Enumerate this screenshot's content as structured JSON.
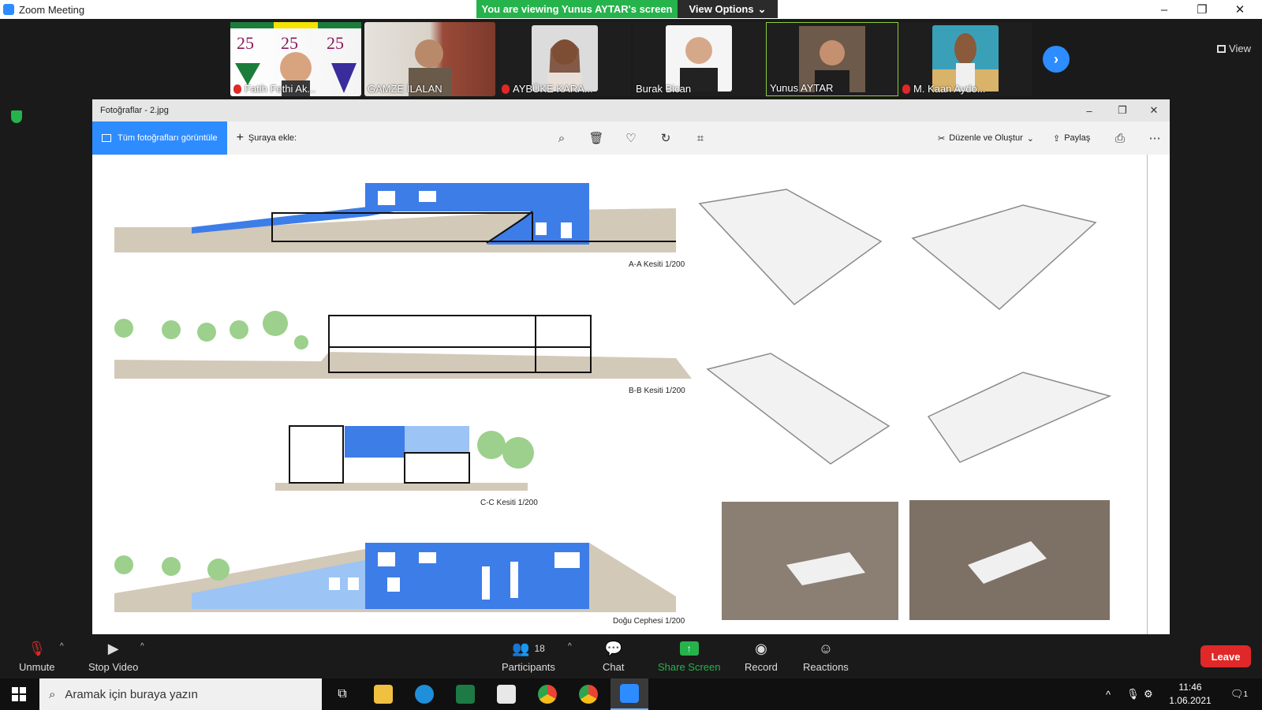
{
  "zoom": {
    "window_title": "Zoom Meeting",
    "viewing_banner": "You are viewing Yunus AYTAR's screen",
    "view_options": "View Options",
    "view_label": "View"
  },
  "participants": [
    {
      "name": "Fatih Fethi Ak...",
      "muted": true,
      "active": false
    },
    {
      "name": "GAMZE İLALAN",
      "muted": false,
      "active": false
    },
    {
      "name": "AYBÜKE KARA...",
      "muted": true,
      "active": false
    },
    {
      "name": "Burak Bican",
      "muted": false,
      "active": false
    },
    {
      "name": "Yunus AYTAR",
      "muted": false,
      "active": true
    },
    {
      "name": "M. Kaan Aydo...",
      "muted": true,
      "active": false
    }
  ],
  "photos_app": {
    "title": "Fotoğraflar - 2.jpg",
    "all_photos": "Tüm fotoğrafları görüntüle",
    "add_to": "Şuraya ekle:",
    "edit_create": "Düzenle ve Oluştur",
    "share": "Paylaş"
  },
  "drawing": {
    "labels": {
      "aa": "A-A Kesiti 1/200",
      "bb": "B-B Kesiti 1/200",
      "cc": "C-C Kesiti 1/200",
      "east": "Doğu Cephesi 1/200"
    }
  },
  "controls": {
    "unmute": "Unmute",
    "stop_video": "Stop Video",
    "participants": "Participants",
    "participants_count": "18",
    "chat": "Chat",
    "share_screen": "Share Screen",
    "record": "Record",
    "reactions": "Reactions",
    "leave": "Leave"
  },
  "taskbar": {
    "search_placeholder": "Aramak için buraya yazın",
    "time": "11:46",
    "date": "1.06.2021",
    "notifications": "1"
  },
  "colors": {
    "zoom_blue": "#2d8cff",
    "banner_green": "#26b34c",
    "leave_red": "#e02828",
    "drawing_blue": "#3d7de8"
  }
}
